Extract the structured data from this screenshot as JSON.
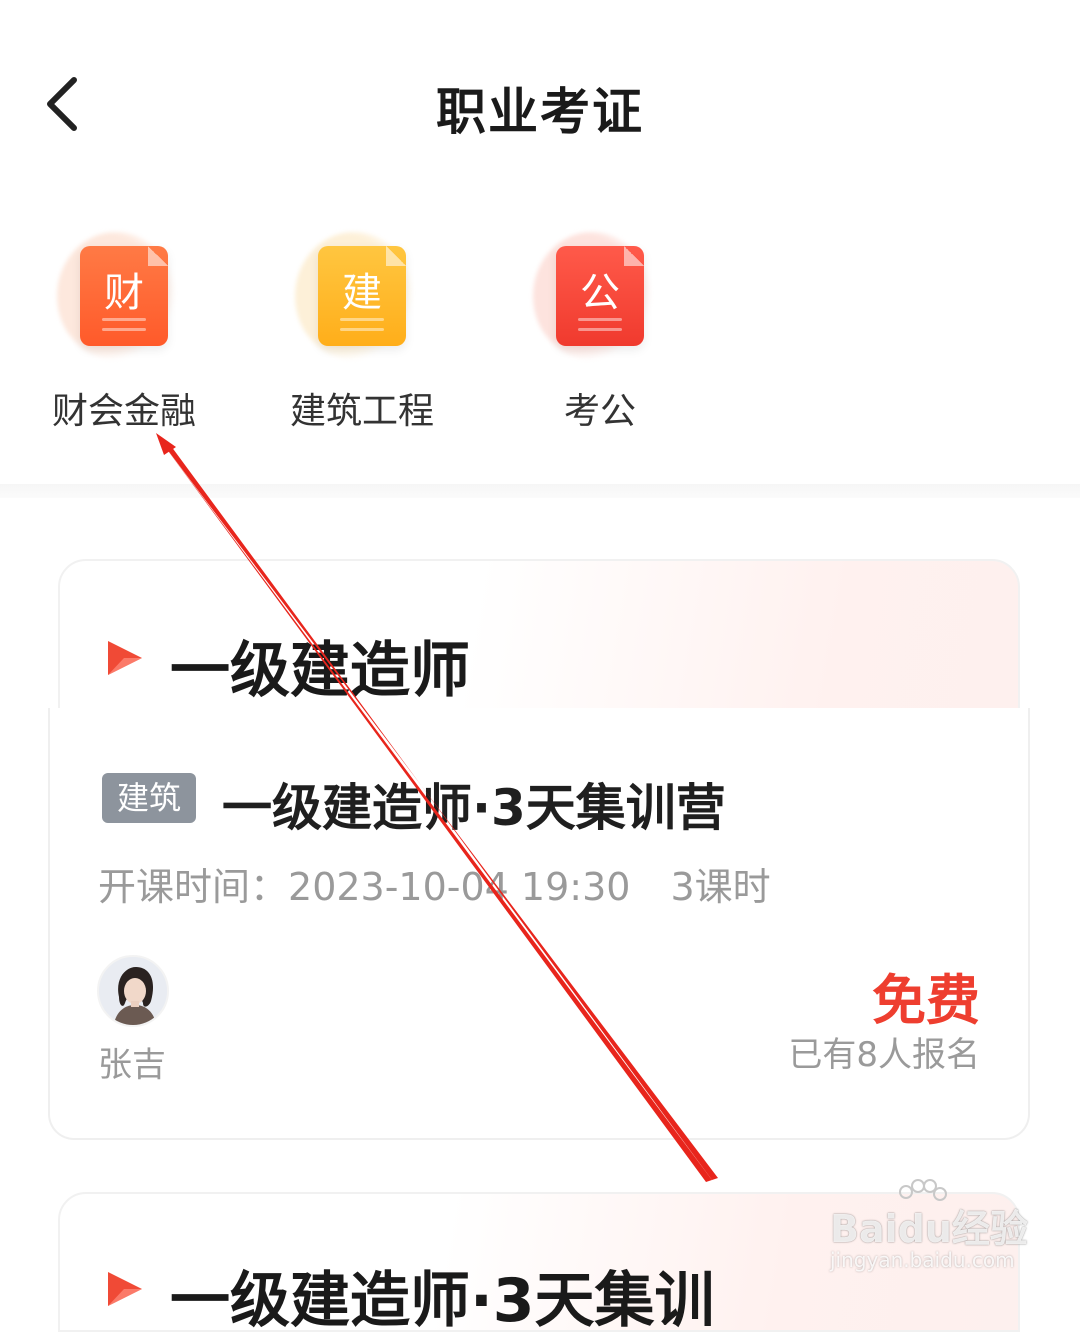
{
  "header": {
    "title": "职业考证"
  },
  "categories": [
    {
      "label": "财会金融",
      "glyph": "财",
      "icon": "finance-doc-icon",
      "color_top": "#ff7a45",
      "color_bottom": "#ff5a2a",
      "halo": "#fde8dd"
    },
    {
      "label": "建筑工程",
      "glyph": "建",
      "icon": "construction-doc-icon",
      "color_top": "#ffc640",
      "color_bottom": "#ffae1a",
      "halo": "#fdf0d8"
    },
    {
      "label": "考公",
      "glyph": "公",
      "icon": "civil-service-doc-icon",
      "color_top": "#ff5a4a",
      "color_bottom": "#f03a2e",
      "halo": "#fde3de"
    }
  ],
  "section": {
    "title": "一级建造师"
  },
  "course": {
    "tag": "建筑",
    "title": "一级建造师·3天集训营",
    "start_label": "开课时间：",
    "start_time": "2023-10-04 19:30",
    "hours": "3课时",
    "teacher": "张吉",
    "price": "免费",
    "enrolled": "已有8人报名"
  },
  "next_section": {
    "title": "一级建造师·3天集训"
  },
  "watermark": {
    "text": "Baidu经验",
    "sub": "jingyan.baidu.com"
  },
  "colors": {
    "accent": "#ee3e2f",
    "annotation_arrow": "#e8251c",
    "tag_bg": "#8d949d"
  }
}
